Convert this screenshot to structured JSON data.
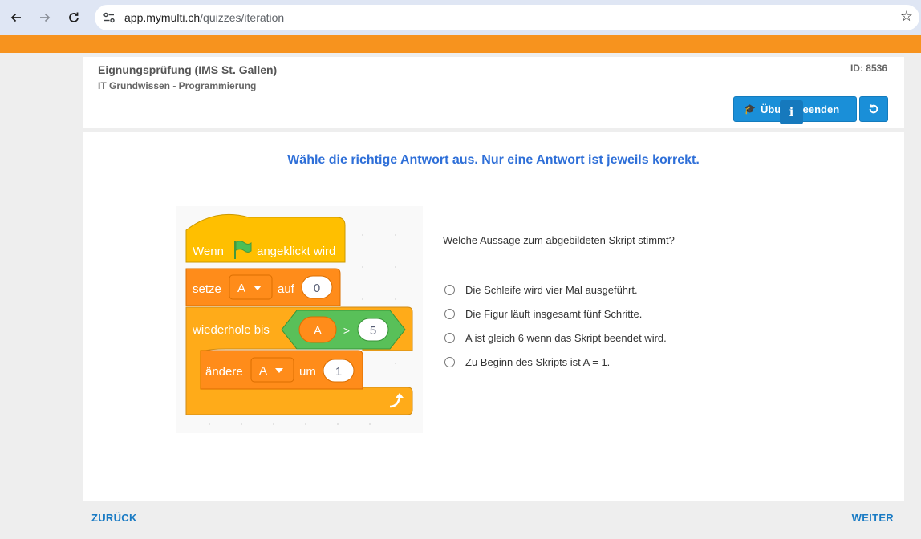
{
  "browser": {
    "url_host": "app.mymulti.ch",
    "url_path": "/quizzes/iteration"
  },
  "header": {
    "title": "Eignungsprüfung (IMS St. Gallen)",
    "subtitle": "IT Grundwissen - Programmierung",
    "id_label": "ID: 8536",
    "exit_button_label": "Übung beenden",
    "info_badge": "i"
  },
  "main": {
    "instruction": "Wähle die richtige Antwort aus. Nur eine Antwort ist jeweils korrekt.",
    "question": "Welche Aussage zum abgebildeten Skript stimmt?",
    "options": [
      "Die Schleife wird vier Mal ausgeführt.",
      "Die Figur läuft insgesamt fünf Schritte.",
      "A ist gleich 6 wenn das Skript beendet wird.",
      "Zu Beginn des Skripts ist A = 1."
    ],
    "script": {
      "hat_label_1": "Wenn",
      "hat_label_2": "angeklickt wird",
      "set_label": "setze",
      "set_var": "A",
      "set_to": "auf",
      "set_value": "0",
      "repeat_label": "wiederhole bis",
      "cond_var": "A",
      "cond_op": ">",
      "cond_value": "5",
      "change_label": "ändere",
      "change_var": "A",
      "change_by": "um",
      "change_value": "1"
    }
  },
  "footer": {
    "back_label": "ZURÜCK",
    "next_label": "WEITER"
  },
  "icons": {
    "back": "arrow-left-icon",
    "forward": "arrow-right-icon",
    "reload": "reload-icon",
    "site_settings": "tune-icon",
    "bookmark": "star-icon",
    "graduation": "graduation-cap-icon",
    "green_flag": "green-flag-icon",
    "loop_arrow": "loop-arrow-icon"
  },
  "colors": {
    "brand_orange": "#f7931e",
    "button_blue": "#1a8fd8",
    "instruction_blue": "#2e6fd8",
    "link_blue": "#1a7bc4",
    "scratch_events": "#ffbf00",
    "scratch_variables": "#ff8c1a",
    "scratch_control": "#ffab19",
    "scratch_operators": "#59c059"
  }
}
